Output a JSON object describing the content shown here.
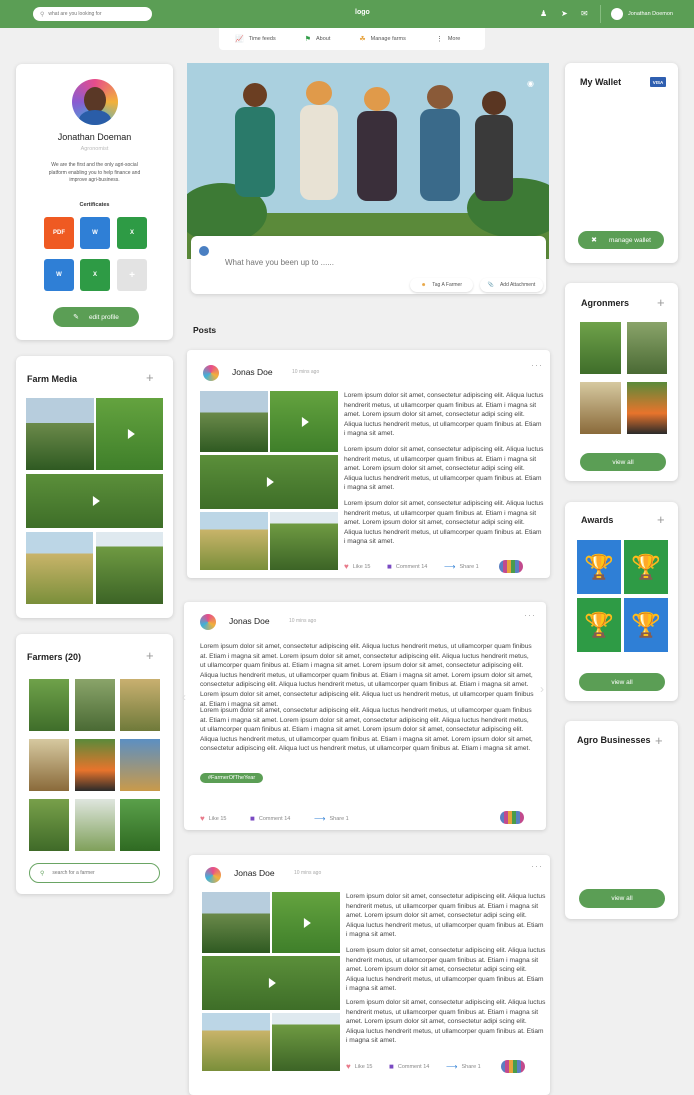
{
  "header": {
    "search_placeholder": "what are you looking for",
    "logo": "logo",
    "user_name": "Jonathan Doemon",
    "icons": [
      "people-icon",
      "send-icon",
      "mail-icon",
      "user-avatar-icon"
    ]
  },
  "nav": {
    "tabs": [
      {
        "label": "Time feeds",
        "icon": "chart-icon"
      },
      {
        "label": "About",
        "icon": "flag-icon"
      },
      {
        "label": "Manage farms",
        "icon": "farm-icon"
      },
      {
        "label": "More",
        "icon": "more-icon"
      }
    ]
  },
  "profile": {
    "name": "Jonathan Doeman",
    "role": "Agronomist",
    "bio": "We are the first and the only agri-social platform enabling you to help finance and improve agri-business.",
    "certificates_title": "Certificates",
    "certificates": [
      {
        "label": "PDF",
        "color": "#ef5a22"
      },
      {
        "label": "W",
        "color": "#2f7fd6"
      },
      {
        "label": "X",
        "color": "#2e9b45"
      },
      {
        "label": "W",
        "color": "#2f7fd6"
      },
      {
        "label": "X",
        "color": "#2e9b45"
      },
      {
        "label": "+",
        "color": "#e3e3e3"
      }
    ],
    "edit_button": "edit profile"
  },
  "farm_media": {
    "title": "Farm Media"
  },
  "farmers": {
    "title": "Farmers (20)",
    "search_placeholder": "search for a farmer"
  },
  "composer": {
    "placeholder": "What have you been up to ......",
    "tag_button": "Tag A Farmer",
    "attach_button": "Add Attachment"
  },
  "posts_heading": "Posts",
  "posts": [
    {
      "author": "Jonas Doe",
      "time": "10 mins ago",
      "paragraphs": [
        "Lorem ipsum dolor sit amet, consectetur adipiscing elit. Aliqua luctus hendrerit metus, ut ullamcorper quam finibus at. Etiam i magna sit amet. Lorem ipsum dolor sit amet, consectetur adipi scing elit. Aliqua luctus hendrerit metus, ut ullamcorper quam finibus at. Etiam i magna sit amet.",
        "Lorem ipsum dolor sit amet, consectetur adipiscing elit. Aliqua luctus hendrerit metus, ut ullamcorper quam finibus at. Etiam i magna sit amet. Lorem ipsum dolor sit amet, consectetur adipi scing elit. Aliqua luctus hendrerit metus, ut ullamcorper quam finibus at. Etiam i magna sit amet.",
        "Lorem ipsum dolor sit amet, consectetur adipiscing elit. Aliqua luctus hendrerit metus, ut ullamcorper quam finibus at. Etiam i magna sit amet. Lorem ipsum dolor sit amet, consectetur adipi scing elit. Aliqua luctus hendrerit metus, ut ullamcorper quam finibus at. Etiam i magna sit amet."
      ],
      "like": "Like 15",
      "comment": "Comment 14",
      "share": "Share 1"
    },
    {
      "author": "Jonas Doe",
      "time": "10 mins ago",
      "text1": "Lorem ipsum dolor sit amet, consectetur adipiscing elit. Aliqua luctus hendrerit metus, ut ullamcorper quam finibus at. Etiam i magna sit amet. Lorem ipsum dolor sit amet, consectetur adipiscing elit. Aliqua luctus hendrerit metus, ut ullamcorper quam finibus at. Etiam i magna sit amet. Lorem ipsum dolor sit amet, consectetur adipiscing elit. Aliqua luctus hendrerit metus, ut ullamcorper quam finibus at. Etiam i magna sit amet. Lorem ipsum dolor sit amet, consectetur adipiscing elit. Aliqua luctus hendrerit metus, ut ullamcorper quam finibus at. Etiam i magna sit amet. Lorem ipsum dolor sit amet, consectetur adipiscing elit. Aliqua luct us hendrerit metus, ut ullamcorper quam finibus at. Etiam i magna sit amet.",
      "text2": "Lorem ipsum dolor sit amet, consectetur adipiscing elit. Aliqua luctus hendrerit metus, ut ullamcorper quam finibus at. Etiam i magna sit amet. Lorem ipsum dolor sit amet, consectetur adipiscing elit. Aliqua luctus hendrerit metus, ut ullamcorper quam finibus at. Etiam i magna sit amet. Lorem ipsum dolor sit amet, consectetur adipiscing elit. Aliqua luctus hendrerit metus, ut ullamcorper quam finibus at. Etiam i magna sit amet. Lorem ipsum dolor sit amet, consectetur adipiscing elit. Aliqua luct us hendrerit metus, ut ullamcorper quam finibus at. Etiam i magna sit amet.",
      "tag": "#FarmerOfTheYear",
      "like": "Like 15",
      "comment": "Comment 14",
      "share": "Share 1"
    },
    {
      "author": "Jonas Doe",
      "time": "10 mins ago",
      "like": "Like 15",
      "comment": "Comment 14",
      "share": "Share 1"
    }
  ],
  "wallet": {
    "title": "My Wallet",
    "card_brand": "VISA",
    "button": "manage wallet"
  },
  "agronomers": {
    "title": "Agronmers",
    "button": "view all"
  },
  "awards": {
    "title": "Awards",
    "button": "view all",
    "tiles": [
      {
        "color": "#2f7fd6"
      },
      {
        "color": "#2e9b45"
      },
      {
        "color": "#2e9b45"
      },
      {
        "color": "#2f7fd6"
      }
    ]
  },
  "agro_businesses": {
    "title": "Agro Businesses",
    "button": "view all"
  }
}
